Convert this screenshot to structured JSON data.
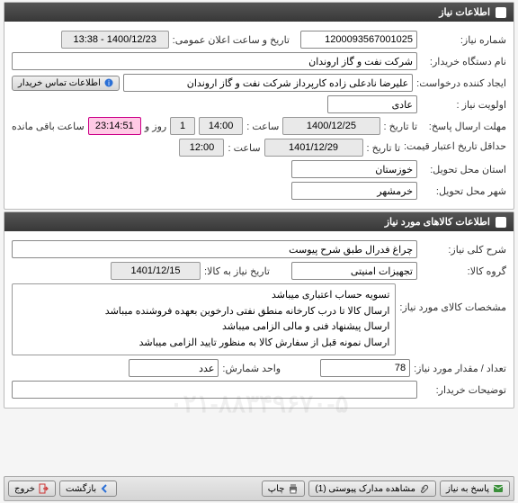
{
  "panel1": {
    "title": "اطلاعات نیاز"
  },
  "need_number": {
    "label": "شماره نیاز:",
    "value": "1200093567001025"
  },
  "announce": {
    "label": "تاریخ و ساعت اعلان عمومی:",
    "value": "1400/12/23 - 13:38"
  },
  "buyer": {
    "label": "نام دستگاه خریدار:",
    "value": "شرکت نفت و گاز اروندان"
  },
  "creator": {
    "label": "ایجاد کننده درخواست:",
    "value": "علیرضا نادعلی زاده کارپرداز شرکت نفت و گاز اروندان"
  },
  "contact_btn": "اطلاعات تماس خریدار",
  "priority": {
    "label": "اولویت نیاز :",
    "value": "عادی"
  },
  "reply_deadline": {
    "label": "مهلت ارسال پاسخ:",
    "to": "تا تاریخ :",
    "date": "1400/12/25",
    "time_label": "ساعت :",
    "time": "14:00",
    "remain_days": "1",
    "remain_days_label": "روز و",
    "remain_time": "23:14:51",
    "remain_suffix": "ساعت باقی مانده"
  },
  "min_validity": {
    "label": "حداقل تاریخ اعتبار\nقیمت:",
    "to": "تا تاریخ :",
    "date": "1401/12/29",
    "time_label": "ساعت :",
    "time": "12:00"
  },
  "province": {
    "label": "استان محل تحویل:",
    "value": "خوزستان"
  },
  "city": {
    "label": "شهر محل تحویل:",
    "value": "خرمشهر"
  },
  "panel2": {
    "title": "اطلاعات کالاهای مورد نیاز"
  },
  "general_desc": {
    "label": "شرح کلی نیاز:",
    "value": "چراغ فدرال طبق شرح پیوست"
  },
  "group_title": {
    "label": "گروه کالا:",
    "value": "تجهیزات امنیتی"
  },
  "need_date": {
    "label": "تاریخ نیاز به کالا:",
    "value": "1401/12/15"
  },
  "spec_label": "مشخصات کالای مورد نیاز:",
  "spec_lines": [
    "تسویه حساب اعتباری میباشد",
    "ارسال کالا تا درب کارخانه منطق نفتی دارخوین بعهده فروشنده میباشد",
    "ارسال پیشنهاد فنی و مالی الزامی میباشد",
    "ارسال نمونه قبل از سفارش کالا به منظور تایید الزامی میباشد"
  ],
  "quantity": {
    "label": "تعداد / مقدار مورد نیاز:",
    "value": "78"
  },
  "unit": {
    "label": "واحد شمارش:",
    "value": "عدد"
  },
  "buyer_notes": {
    "label": "توضیحات خریدار:"
  },
  "footer": {
    "reply": "پاسخ به نیاز",
    "attachments": "مشاهده مدارک پیوستی (1)",
    "print": "چاپ",
    "back": "بازگشت",
    "exit": "خروج"
  },
  "watermark": "۰۲۱-۸۸۳۴۹۶۷۰-۵"
}
